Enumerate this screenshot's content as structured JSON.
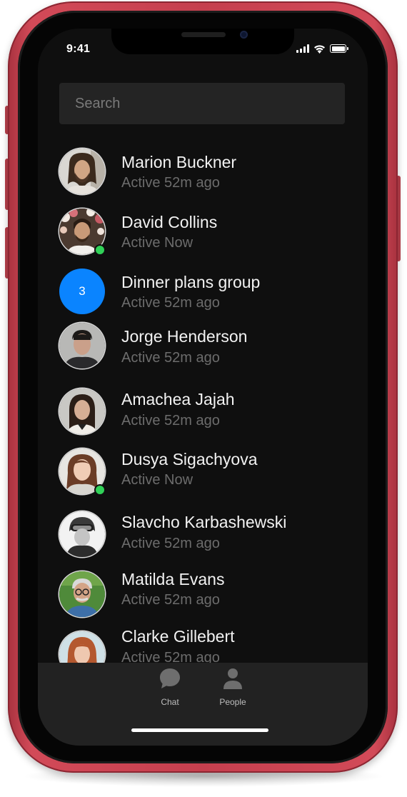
{
  "status_bar": {
    "time": "9:41"
  },
  "search": {
    "placeholder": "Search"
  },
  "people": [
    {
      "name": "Marion Buckner",
      "status": "Active 52m ago",
      "online": false
    },
    {
      "name": "David Collins",
      "status": "Active Now",
      "online": true
    },
    {
      "name": "Dinner plans group",
      "status": "Active 52m ago",
      "online": false,
      "group_count": "3"
    },
    {
      "name": "Jorge Henderson",
      "status": "Active 52m ago",
      "online": false
    },
    {
      "name": "Amachea Jajah",
      "status": "Active 52m ago",
      "online": false
    },
    {
      "name": "Dusya Sigachyova",
      "status": "Active Now",
      "online": true
    },
    {
      "name": "Slavcho Karbashewski",
      "status": "Active 52m ago",
      "online": false
    },
    {
      "name": "Matilda Evans",
      "status": "Active 52m ago",
      "online": false
    },
    {
      "name": "Clarke Gillebert",
      "status": "Active 52m ago",
      "online": false
    }
  ],
  "tab_bar": {
    "tabs": [
      {
        "label": "Chat",
        "icon": "chat-bubble-icon"
      },
      {
        "label": "People",
        "icon": "person-icon"
      }
    ]
  },
  "colors": {
    "frame": "#c53f4e",
    "screen_background": "#0f0f0f",
    "search_background": "#242424",
    "group_avatar": "#0a84ff",
    "online_dot": "#31d158",
    "tab_bar_background": "#222222"
  }
}
